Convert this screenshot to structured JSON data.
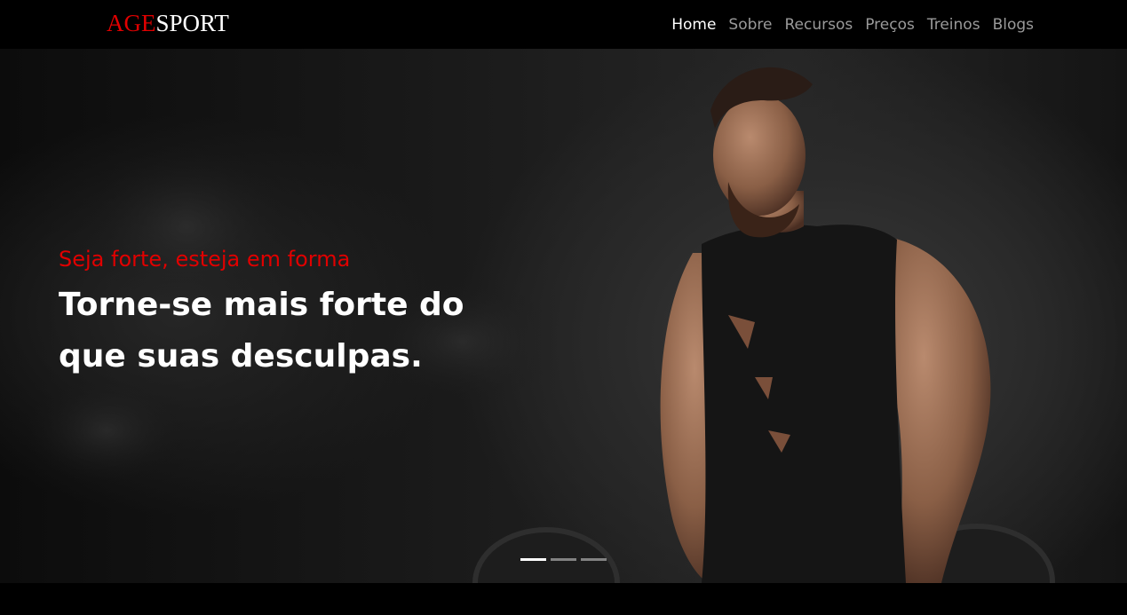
{
  "brand": {
    "accent": "AGE",
    "rest": "SPORT"
  },
  "nav": {
    "items": [
      {
        "label": "Home",
        "active": true
      },
      {
        "label": "Sobre",
        "active": false
      },
      {
        "label": "Recursos",
        "active": false
      },
      {
        "label": "Preços",
        "active": false
      },
      {
        "label": "Treinos",
        "active": false
      },
      {
        "label": "Blogs",
        "active": false
      }
    ]
  },
  "hero": {
    "subtitle": "Seja forte, esteja em forma",
    "title_line1": "Torne-se mais forte do",
    "title_line2": "que suas desculpas.",
    "slides": 3,
    "active_slide": 1
  },
  "colors": {
    "accent": "#e00000",
    "nav_active": "#ffffff",
    "nav_inactive": "#9a9a9a",
    "background": "#000000"
  },
  "icons": {
    "hero_image": "bodybuilder-photo"
  }
}
